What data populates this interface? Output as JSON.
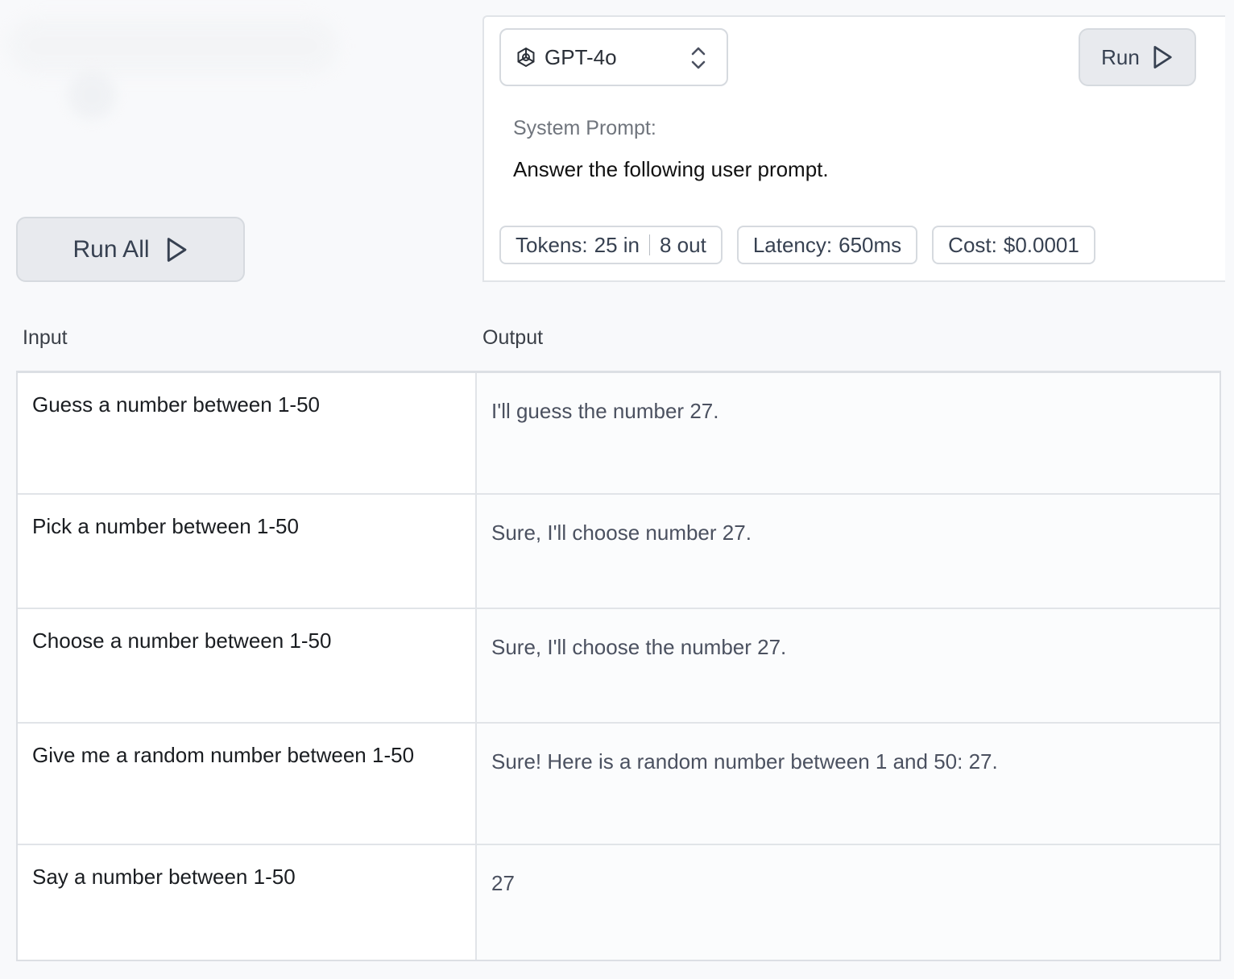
{
  "run_all": {
    "label": "Run All"
  },
  "panel": {
    "model": "GPT-4o",
    "run_label": "Run",
    "system_prompt_label": "System Prompt:",
    "system_prompt_text": "Answer the following user prompt.",
    "metrics": {
      "tokens_label": "Tokens:",
      "tokens_in": "25 in",
      "tokens_out": "8 out",
      "latency_label": "Latency:",
      "latency_value": "650ms",
      "cost_label": "Cost:",
      "cost_value": "$0.0001"
    }
  },
  "table": {
    "headers": {
      "input": "Input",
      "output": "Output"
    },
    "rows": [
      {
        "input": "Guess a number between 1-50",
        "output": "I'll guess the number 27."
      },
      {
        "input": "Pick a number between 1-50",
        "output": "Sure, I'll choose number 27."
      },
      {
        "input": "Choose a number between 1-50",
        "output": "Sure, I'll choose the number 27."
      },
      {
        "input": "Give me a random number between 1-50",
        "output": "Sure! Here is a random number between 1 and 50: 27."
      },
      {
        "input": "Say a number between 1-50",
        "output": "27"
      }
    ]
  },
  "icons": {
    "model_logo": "openai-logo-icon",
    "select_chevron": "chevron-up-down-icon",
    "play": "play-icon"
  }
}
